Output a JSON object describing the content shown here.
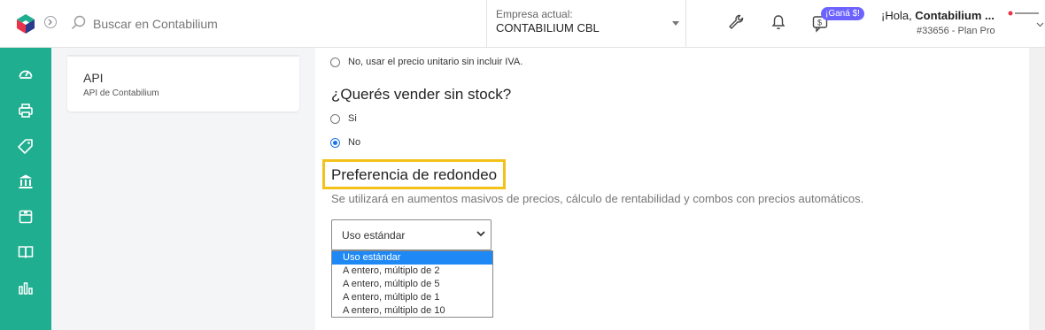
{
  "header": {
    "search_placeholder": "Buscar en Contabilium",
    "company_label": "Empresa actual:",
    "company_name": "CONTABILIUM CBL",
    "promo_badge": "¡Ganá $!",
    "greeting_prefix": "¡Hola, ",
    "greeting_name": "Contabilium ...",
    "plan": "#33656 - Plan Pro"
  },
  "sidebar": {
    "items": [
      "dashboard-icon",
      "printer-icon",
      "tag-icon",
      "bank-icon",
      "save-icon",
      "book-icon",
      "bar-chart-icon"
    ]
  },
  "left": {
    "api_title": "API",
    "api_subtitle": "API de Contabilium"
  },
  "main": {
    "iva_option_label": "No, usar el precio unitario sin incluir IVA.",
    "stock_title": "¿Querés vender sin stock?",
    "stock_options": [
      {
        "label": "Si",
        "checked": false
      },
      {
        "label": "No",
        "checked": true
      }
    ],
    "rounding_title": "Preferencia de redondeo",
    "rounding_help": "Se utilizará en aumentos masivos de precios, cálculo de rentabilidad y combos con precios automáticos.",
    "rounding_selected": "Uso estándar",
    "rounding_options": [
      "Uso estándar",
      "A entero, múltiplo de 2",
      "A entero, múltiplo de 5",
      "A entero, múltiplo de 1",
      "A entero, múltiplo de 10"
    ]
  },
  "colors": {
    "sidebar": "#1fae8f",
    "highlight": "#f2c21b",
    "selected_option": "#1e88f5",
    "badge": "#6c63ff"
  }
}
